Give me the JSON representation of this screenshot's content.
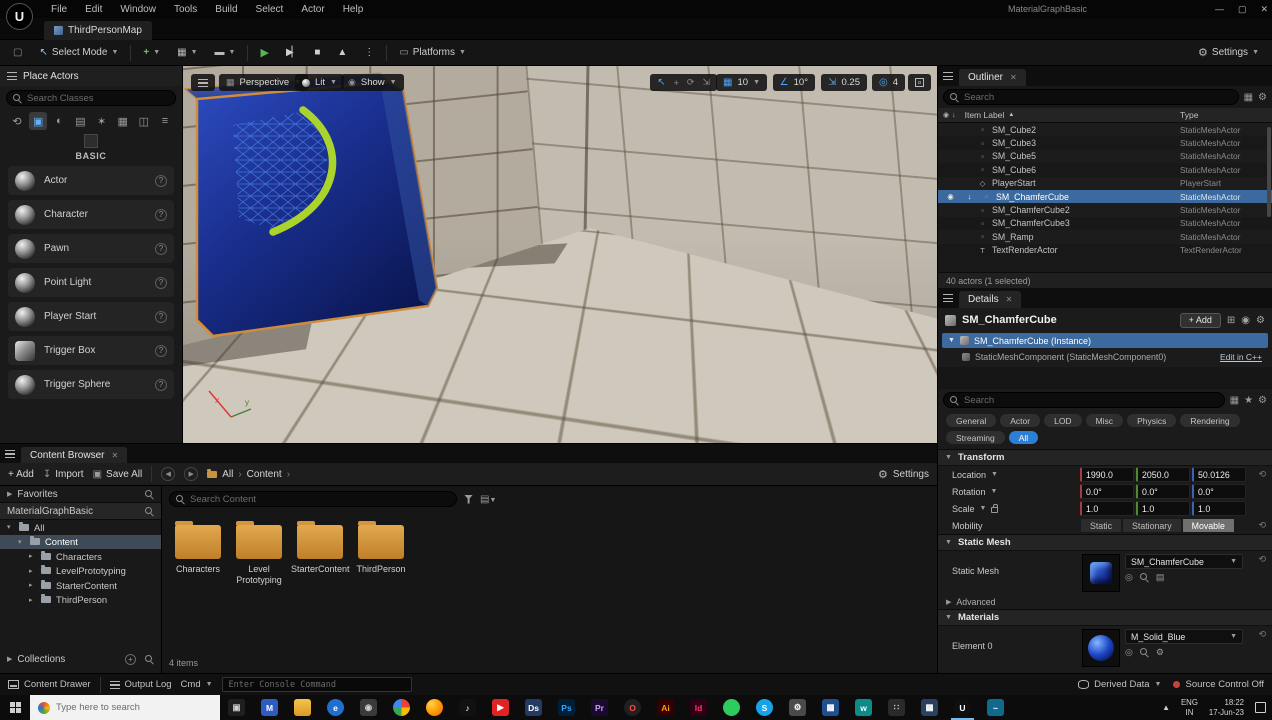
{
  "titlebar": {
    "menus": [
      "File",
      "Edit",
      "Window",
      "Tools",
      "Build",
      "Select",
      "Actor",
      "Help"
    ],
    "project_title": "MaterialGraphBasic",
    "logo_glyph": "U"
  },
  "tabbar": {
    "level_tab": "ThirdPersonMap"
  },
  "toolbar": {
    "select_mode": "Select Mode",
    "platforms": "Platforms",
    "settings": "Settings"
  },
  "place_actors": {
    "title": "Place Actors",
    "search_placeholder": "Search Classes",
    "category_label": "BASIC",
    "categories": [
      {
        "name": "recently-placed",
        "glyph": "⟲"
      },
      {
        "name": "basic",
        "glyph": "▣",
        "active": true
      },
      {
        "name": "lights",
        "glyph": "◐"
      },
      {
        "name": "cinematic",
        "glyph": "▤"
      },
      {
        "name": "visual-effects",
        "glyph": "✶"
      },
      {
        "name": "geometry",
        "glyph": "▦"
      },
      {
        "name": "volumes",
        "glyph": "◫"
      },
      {
        "name": "all-classes",
        "glyph": "≡"
      }
    ],
    "items": [
      {
        "label": "Actor",
        "icon": "sphere"
      },
      {
        "label": "Character",
        "icon": "sphere"
      },
      {
        "label": "Pawn",
        "icon": "sphere"
      },
      {
        "label": "Point Light",
        "icon": "sphere"
      },
      {
        "label": "Player Start",
        "icon": "sphere"
      },
      {
        "label": "Trigger Box",
        "icon": "box"
      },
      {
        "label": "Trigger Sphere",
        "icon": "sphere"
      }
    ]
  },
  "viewport": {
    "perspective": "Perspective",
    "lit": "Lit",
    "show": "Show",
    "grid_snap": "10",
    "angle_snap": "10°",
    "scale_snap": "0.25",
    "camera_speed": "4",
    "axis_x": "x",
    "axis_y": "y"
  },
  "outliner": {
    "tab_title": "Outliner",
    "search_placeholder": "Search",
    "item_label_column": "Item Label",
    "type_column": "Type",
    "rows": [
      {
        "label": "SM_Cube2",
        "type": "StaticMeshActor",
        "icon_glyph": "▫",
        "selected": false
      },
      {
        "label": "SM_Cube3",
        "type": "StaticMeshActor",
        "icon_glyph": "▫",
        "selected": false
      },
      {
        "label": "SM_Cube5",
        "type": "StaticMeshActor",
        "icon_glyph": "▫",
        "selected": false
      },
      {
        "label": "SM_Cube6",
        "type": "StaticMeshActor",
        "icon_glyph": "▫",
        "selected": false
      },
      {
        "label": "PlayerStart",
        "type": "PlayerStart",
        "icon_glyph": "◇",
        "selected": false
      },
      {
        "label": "SM_ChamferCube",
        "type": "StaticMeshActor",
        "icon_glyph": "▫",
        "selected": true
      },
      {
        "label": "SM_ChamferCube2",
        "type": "StaticMeshActor",
        "icon_glyph": "▫",
        "selected": false
      },
      {
        "label": "SM_ChamferCube3",
        "type": "StaticMeshActor",
        "icon_glyph": "▫",
        "selected": false
      },
      {
        "label": "SM_Ramp",
        "type": "StaticMeshActor",
        "icon_glyph": "▫",
        "selected": false
      },
      {
        "label": "TextRenderActor",
        "type": "TextRenderActor",
        "icon_glyph": "T",
        "selected": false
      }
    ],
    "footer": "40 actors (1 selected)"
  },
  "details": {
    "tab_title": "Details",
    "actor_name": "SM_ChamferCube",
    "add_button": "+ Add",
    "instance_label": "SM_ChamferCube (Instance)",
    "component_label": "StaticMeshComponent (StaticMeshComponent0)",
    "edit_cpp": "Edit in C++",
    "search_placeholder": "Search",
    "filters": [
      {
        "label": "General"
      },
      {
        "label": "Actor"
      },
      {
        "label": "LOD"
      },
      {
        "label": "Misc"
      },
      {
        "label": "Physics"
      },
      {
        "label": "Rendering"
      },
      {
        "label": "Streaming"
      },
      {
        "label": "All",
        "active": true
      }
    ],
    "transform": {
      "section": "Transform",
      "location_label": "Location",
      "location": [
        "1990.0",
        "2050.0",
        "50.0126"
      ],
      "rotation_label": "Rotation",
      "rotation": [
        "0.0°",
        "0.0°",
        "0.0°"
      ],
      "scale_label": "Scale",
      "scale": [
        "1.0",
        "1.0",
        "1.0"
      ],
      "mobility_label": "Mobility",
      "mobility_options": [
        "Static",
        "Stationary",
        "Movable"
      ],
      "mobility_selected": "Movable"
    },
    "static_mesh": {
      "section": "Static Mesh",
      "row_label": "Static Mesh",
      "value": "SM_ChamferCube"
    },
    "advanced_label": "Advanced",
    "materials": {
      "section": "Materials",
      "element_label": "Element 0",
      "value": "M_Solid_Blue"
    }
  },
  "content_browser": {
    "tab_title": "Content Browser",
    "add_button": "+ Add",
    "import_button": "Import",
    "save_all_button": "Save All",
    "root_crumb": "All",
    "path_crumb": "Content",
    "settings_label": "Settings",
    "search_placeholder": "Search Content",
    "favorites_label": "Favorites",
    "project_root_label": "MaterialGraphBasic",
    "tree": [
      {
        "label": "All",
        "depth": 0,
        "caret": "▾",
        "selected": false
      },
      {
        "label": "Content",
        "depth": 1,
        "caret": "▾",
        "selected": true
      },
      {
        "label": "Characters",
        "depth": 2,
        "caret": "▸",
        "selected": false
      },
      {
        "label": "LevelPrototyping",
        "depth": 2,
        "caret": "▸",
        "selected": false
      },
      {
        "label": "StarterContent",
        "depth": 2,
        "caret": "▸",
        "selected": false
      },
      {
        "label": "ThirdPerson",
        "depth": 2,
        "caret": "▸",
        "selected": false
      }
    ],
    "folders": [
      "Characters",
      "Level Prototyping",
      "StarterContent",
      "ThirdPerson"
    ],
    "items_count": "4 items",
    "collections_label": "Collections"
  },
  "status_bar": {
    "content_drawer": "Content Drawer",
    "output_log": "Output Log",
    "cmd": "Cmd",
    "console_placeholder": "Enter Console Command",
    "derived_data": "Derived Data",
    "source_control": "Source Control Off"
  },
  "taskbar": {
    "search_placeholder": "Type here to search",
    "icons": [
      {
        "name": "task-view",
        "bg": "#1f1f1f",
        "fg": "#cfcfcf",
        "glyph": "▣",
        "shape": "square"
      },
      {
        "name": "office-blue",
        "bg": "#2d5bbf",
        "glyph": "M",
        "shape": "square"
      },
      {
        "name": "file-explorer",
        "bg": "linear-gradient(180deg,#f5c548,#d99a28)",
        "glyph": "",
        "shape": "square"
      },
      {
        "name": "edge",
        "bg": "#1e6fd0",
        "glyph": "e",
        "shape": "circle"
      },
      {
        "name": "camera",
        "bg": "#3a3a3a",
        "fg": "#cfcfcf",
        "glyph": "◉",
        "shape": "square"
      },
      {
        "name": "chrome",
        "bg": "conic-gradient(#ea4335 0 25%,#fbbc05 0 50%,#34a853 0 75%,#4285f4 0 100%)",
        "glyph": "",
        "shape": "circle"
      },
      {
        "name": "firefox",
        "bg": "radial-gradient(circle at 32% 30%,#ffd24a,#ff9500 55%,#e4572e)",
        "glyph": "",
        "shape": "circle"
      },
      {
        "name": "tiktok",
        "bg": "#111",
        "glyph": "♪",
        "shape": "square"
      },
      {
        "name": "youtube",
        "bg": "#e02424",
        "glyph": "▶",
        "shape": "square"
      },
      {
        "name": "davinci",
        "bg": "#233a63",
        "glyph": "Ds",
        "shape": "square"
      },
      {
        "name": "photoshop",
        "bg": "#001e36",
        "fg": "#31a8ff",
        "glyph": "Ps",
        "shape": "square"
      },
      {
        "name": "premiere",
        "bg": "#1a0b2e",
        "fg": "#cf96fd",
        "glyph": "Pr",
        "shape": "square"
      },
      {
        "name": "opera",
        "bg": "#202020",
        "fg": "#ff4b4b",
        "glyph": "O",
        "shape": "circle"
      },
      {
        "name": "illustrator",
        "bg": "#330000",
        "fg": "#ff9a00",
        "glyph": "Ai",
        "shape": "square"
      },
      {
        "name": "indesign",
        "bg": "#2e0015",
        "fg": "#ff3366",
        "glyph": "Id",
        "shape": "square"
      },
      {
        "name": "whatsapp",
        "bg": "#2ecc5e",
        "glyph": "",
        "shape": "circle"
      },
      {
        "name": "skype",
        "bg": "#18a3e8",
        "glyph": "S",
        "shape": "circle"
      },
      {
        "name": "settings-app",
        "bg": "#4a4a4a",
        "glyph": "⚙",
        "shape": "square"
      },
      {
        "name": "photos",
        "bg": "#1f4f8f",
        "glyph": "▦",
        "shape": "square"
      },
      {
        "name": "wave-teal",
        "bg": "#0d8a8a",
        "glyph": "w",
        "shape": "square"
      },
      {
        "name": "app-grid",
        "bg": "#2a2a2a",
        "fg": "#cfcfcf",
        "glyph": "∷",
        "shape": "square"
      },
      {
        "name": "movie-blue",
        "bg": "#27415f",
        "glyph": "▦",
        "shape": "square"
      },
      {
        "name": "unreal-engine",
        "bg": "#101010",
        "fg": "#ffffff",
        "glyph": "U",
        "shape": "circle",
        "active": true
      },
      {
        "name": "tilde-teal",
        "bg": "#11698e",
        "glyph": "~",
        "shape": "square"
      }
    ],
    "tray": {
      "lang": "ENG",
      "region": "IN",
      "time": "18:22",
      "date": "17-Jun-23"
    }
  }
}
